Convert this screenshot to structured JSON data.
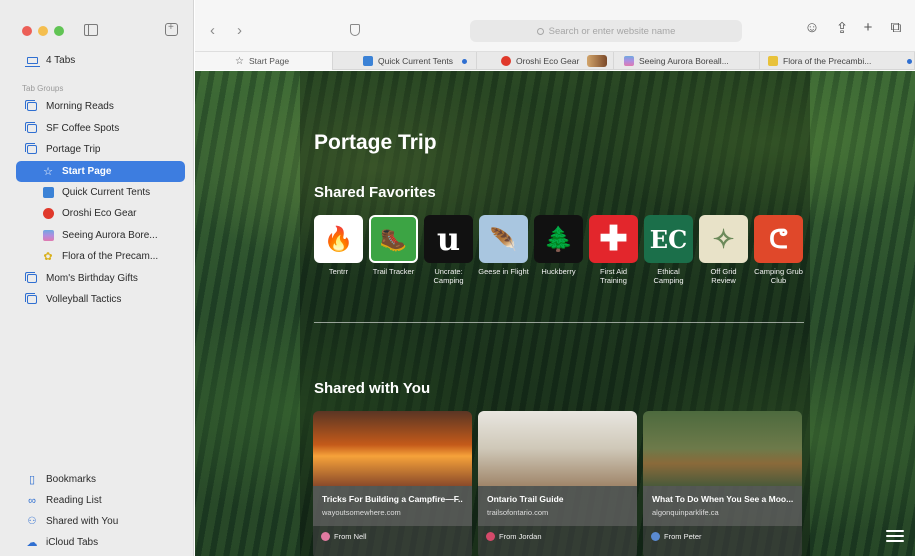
{
  "sidebar": {
    "all_tabs": "4 Tabs",
    "section_label": "Tab Groups",
    "groups": [
      {
        "label": "Morning Reads"
      },
      {
        "label": "SF Coffee Spots"
      },
      {
        "label": "Portage Trip"
      }
    ],
    "portage_tabs": [
      {
        "label": "Start Page",
        "color": "#3d7de0"
      },
      {
        "label": "Quick Current Tents",
        "color": "#3b82d6"
      },
      {
        "label": "Oroshi Eco Gear",
        "color": "#e0392b"
      },
      {
        "label": "Seeing Aurora Bore...",
        "color": "#8d7fd0"
      },
      {
        "label": "Flora of the Precam...",
        "color": "#e8c23a"
      }
    ],
    "groups_after": [
      {
        "label": "Mom's Birthday Gifts"
      },
      {
        "label": "Volleyball Tactics"
      }
    ],
    "bottom": [
      {
        "label": "Bookmarks",
        "icon": "bookmark-icon"
      },
      {
        "label": "Reading List",
        "icon": "reading-list-icon"
      },
      {
        "label": "Shared with You",
        "icon": "shared-with-you-icon"
      },
      {
        "label": "iCloud Tabs",
        "icon": "icloud-icon"
      }
    ]
  },
  "toolbar": {
    "back": "‹",
    "forward": "›",
    "address_placeholder": "Search or enter website name"
  },
  "tabs": [
    {
      "label": "Start Page",
      "star": "☆"
    },
    {
      "label": "Quick Current Tents",
      "color": "#3b82d6"
    },
    {
      "label": "Oroshi Eco Gear",
      "color": "#e0392b"
    },
    {
      "label": "Seeing Aurora Boreall...",
      "color": "#b08de0"
    },
    {
      "label": "Flora of the Precambi...",
      "color": "#e8c23a"
    }
  ],
  "start_page": {
    "group_title": "Portage Trip",
    "favorites_heading": "Shared Favorites",
    "favorites": [
      {
        "label": "Tentrr",
        "bg": "#ffffff",
        "fg": "#e04a1a",
        "glyph": "🔥"
      },
      {
        "label": "Trail Tracker",
        "bg": "#3ca444",
        "fg": "#ffffff",
        "glyph": "🥾"
      },
      {
        "label": "Uncrate: Camping",
        "bg": "#111111",
        "fg": "#ffffff",
        "glyph": "u"
      },
      {
        "label": "Geese in Flight",
        "bg": "#a9c6e0",
        "fg": "#333333",
        "glyph": "🪶"
      },
      {
        "label": "Huckberry",
        "bg": "#111111",
        "fg": "#ffffff",
        "glyph": "🌲"
      },
      {
        "label": "First Aid Training",
        "bg": "#e3262c",
        "fg": "#ffffff",
        "glyph": "✚"
      },
      {
        "label": "Ethical Camping",
        "bg": "#1b6f4a",
        "fg": "#ffffff",
        "glyph": "EC"
      },
      {
        "label": "Off Grid Review",
        "bg": "#e8e2c8",
        "fg": "#6c8a5a",
        "glyph": "✧"
      },
      {
        "label": "Camping Grub Club",
        "bg": "#e0482a",
        "fg": "#ffffff",
        "glyph": "ᕦ"
      }
    ],
    "shared_heading": "Shared with You",
    "shared": [
      {
        "title": "Tricks For Building a Campfire—F...",
        "url": "wayoutsomewhere.com",
        "from": "From Nell",
        "av": "#e07aa0",
        "img": "linear-gradient(180deg,#5a3524 0%,#c45a1a 45%,#f6a23a 60%,#8a4a2a 100%)"
      },
      {
        "title": "Ontario Trail Guide",
        "url": "trailsofontario.com",
        "from": "From Jordan",
        "av": "#d44a6a",
        "img": "linear-gradient(180deg,#e8e6e0 0%,#cfc8b8 50%,#a0866a 100%)"
      },
      {
        "title": "What To Do When You See a Moo...",
        "url": "algonquinparklife.ca",
        "from": "From Peter",
        "av": "#5a8ad0",
        "img": "linear-gradient(180deg,#4d6a3e 0%,#6d7a4a 50%,#8a6a3a 70%,#4a5a3a 100%)"
      }
    ]
  }
}
